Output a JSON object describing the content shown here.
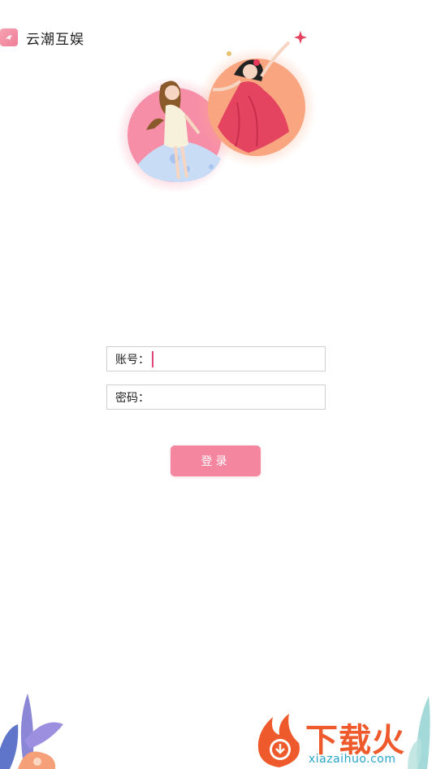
{
  "header": {
    "app_name": "云潮互娱"
  },
  "form": {
    "account_label": "账号：",
    "account_value": "",
    "password_label": "密码：",
    "password_value": "",
    "login_label": "登录"
  },
  "watermark": {
    "brand_text": "下载火",
    "url_text": "xiazaihuo.com"
  },
  "colors": {
    "accent": "#f4879f",
    "caret": "#e2457a",
    "watermark_brand": "#ef5a2c",
    "watermark_url": "#27a6c9"
  },
  "icons": {
    "app_logo": "app-logo-icon",
    "watermark_logo": "flame-download-icon"
  }
}
